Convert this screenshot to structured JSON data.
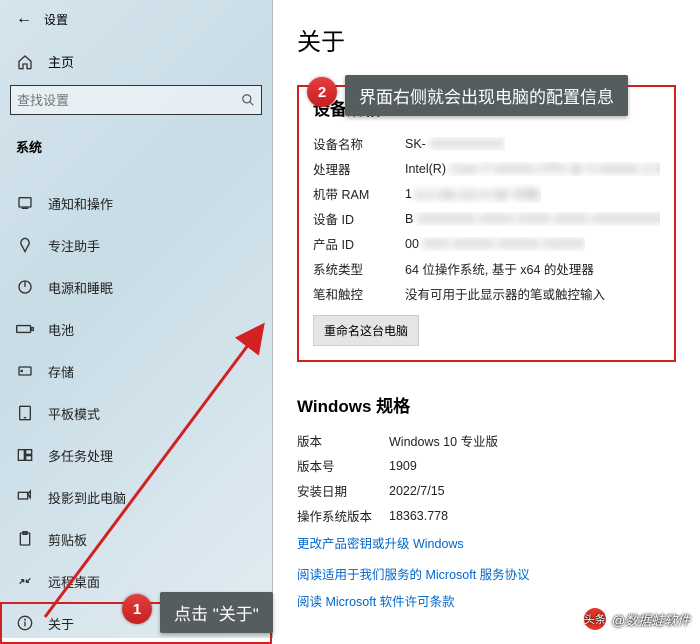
{
  "titlebar": {
    "settings": "设置"
  },
  "sidebar": {
    "home": "主页",
    "search_placeholder": "查找设置",
    "section": "系统",
    "items": [
      {
        "label": "通知和操作",
        "icon": "notify"
      },
      {
        "label": "专注助手",
        "icon": "focus"
      },
      {
        "label": "电源和睡眠",
        "icon": "power"
      },
      {
        "label": "电池",
        "icon": "battery"
      },
      {
        "label": "存储",
        "icon": "storage"
      },
      {
        "label": "平板模式",
        "icon": "tablet"
      },
      {
        "label": "多任务处理",
        "icon": "multitask"
      },
      {
        "label": "投影到此电脑",
        "icon": "project"
      },
      {
        "label": "剪贴板",
        "icon": "clipboard"
      },
      {
        "label": "远程桌面",
        "icon": "remote"
      },
      {
        "label": "关于",
        "icon": "about"
      }
    ]
  },
  "main": {
    "title": "关于",
    "device_spec": {
      "heading": "设备规格",
      "rows": {
        "device_name": {
          "k": "设备名称",
          "prefix": "SK-",
          "blur": "XXXXXXXXX"
        },
        "processor": {
          "k": "处理器",
          "prefix": "Intel(R)",
          "blur": "Core  i7-XXXXU CPU @ X.XXGHz   2.XXGHz"
        },
        "ram": {
          "k": "机带 RAM",
          "prefix": "1",
          "blur": "6.0 GB (15.9 GB 可用)"
        },
        "device_id": {
          "k": "设备 ID",
          "prefix": "B",
          "blur": "XXXXXXX-XXXX-XXXX-XXXX-XXXXXXXXXXX"
        },
        "product_id": {
          "k": "产品 ID",
          "prefix": "00",
          "blur": "XXX-XXXXX-XXXXX-XXXXX"
        },
        "sys_type": {
          "k": "系统类型",
          "v": "64 位操作系统, 基于 x64 的处理器"
        },
        "pen_touch": {
          "k": "笔和触控",
          "v": "没有可用于此显示器的笔或触控输入"
        }
      },
      "rename_btn": "重命名这台电脑"
    },
    "win_spec": {
      "heading": "Windows 规格",
      "rows": {
        "edition": {
          "k": "版本",
          "v": "Windows 10 专业版"
        },
        "version": {
          "k": "版本号",
          "v": "1909"
        },
        "install": {
          "k": "安装日期",
          "v": "2022/7/15"
        },
        "os_build": {
          "k": "操作系统版本",
          "v": "18363.778"
        }
      },
      "link1": "更改产品密钥或升级 Windows",
      "link2": "阅读适用于我们服务的 Microsoft 服务协议",
      "link3": "阅读 Microsoft 软件许可条款"
    }
  },
  "annotations": {
    "step1_num": "1",
    "step1_text": "点击 \"关于\"",
    "step2_num": "2",
    "step2_text": "界面右侧就会出现电脑的配置信息"
  },
  "watermark": {
    "badge": "头条",
    "text": "@数据蛙软件"
  }
}
